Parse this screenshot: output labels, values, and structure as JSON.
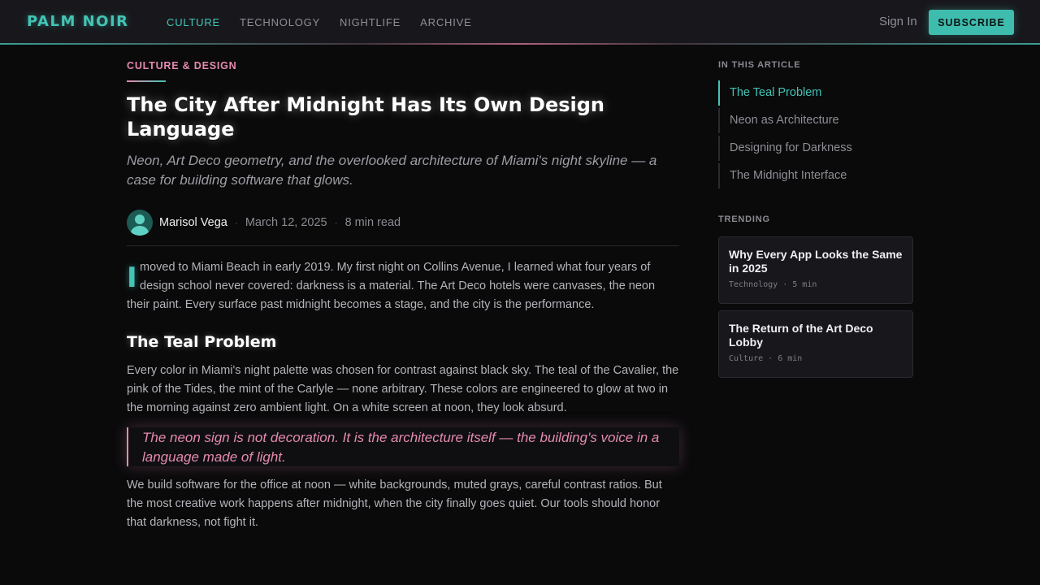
{
  "header": {
    "logo": "PALM NOIR",
    "nav": [
      "CULTURE",
      "TECHNOLOGY",
      "NIGHTLIFE",
      "ARCHIVE"
    ],
    "active_nav": "CULTURE",
    "sign_in": "Sign In",
    "subscribe": "SUBSCRIBE"
  },
  "article": {
    "category": "CULTURE & DESIGN",
    "title": "The City After Midnight Has Its Own Design Language",
    "subtitle": "Neon, Art Deco geometry, and the overlooked architecture of Miami's night skyline — a case for building software that glows.",
    "author": "Marisol Vega",
    "date": "March 12, 2025",
    "read_time": "8 min read",
    "dropcap": "I",
    "p1_lines": [
      "moved to Miami Beach in early 2019. My first night on Collins Avenue, I learned what four years of",
      "design school never covered: darkness is a material. The Art Deco hotels were canvases, the neon",
      "their paint. Every surface past midnight becomes a stage, and the city is the performance."
    ],
    "section_heading": "The Teal Problem",
    "p2": "Every color in Miami's night palette was chosen for contrast against black sky. The teal of the Cavalier, the pink of the Tides, the mint of the Carlyle — none arbitrary. These colors are engineered to glow at two in the morning against zero ambient light. On a white screen at noon, they look absurd.",
    "quote": "The neon sign is not decoration. It is the architecture itself — the building's voice in a language made of light.",
    "p3": "We build software for the office at noon — white backgrounds, muted grays, careful contrast ratios. But the most creative work happens after midnight, when the city finally goes quiet. Our tools should honor that darkness, not fight it."
  },
  "sidebar": {
    "toc_heading": "IN THIS ARTICLE",
    "toc": [
      "The Teal Problem",
      "Neon as Architecture",
      "Designing for Darkness",
      "The Midnight Interface"
    ],
    "trending_heading": "TRENDING",
    "trending": [
      {
        "title": "Why Every App Looks the Same in 2025",
        "meta": "Technology · 5 min"
      },
      {
        "title": "The Return of the Art Deco Lobby",
        "meta": "Culture · 6 min"
      }
    ]
  },
  "colors": {
    "accent_teal": "#43c4b6",
    "accent_pink": "#e58aae",
    "background": "#0a0a0b"
  }
}
